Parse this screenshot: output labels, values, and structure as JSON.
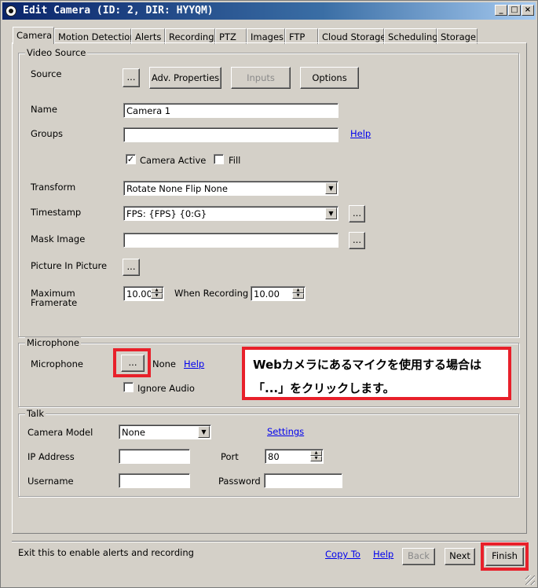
{
  "window": {
    "title": "Edit Camera (ID: 2, DIR: HYYQM)",
    "min": "_",
    "max": "□",
    "close": "×"
  },
  "tabs": [
    "Camera",
    "Motion Detection",
    "Alerts",
    "Recording",
    "PTZ",
    "Images",
    "FTP",
    "Cloud Storage",
    "Scheduling",
    "Storage"
  ],
  "video_source": {
    "group_label": "Video Source",
    "source_label": "Source",
    "source_browse": "...",
    "adv_properties": "Adv. Properties",
    "inputs": "Inputs",
    "options": "Options",
    "name_label": "Name",
    "name_value": "Camera 1",
    "groups_label": "Groups",
    "groups_value": "",
    "groups_help": "Help",
    "camera_active_label": "Camera Active",
    "camera_active_checked": true,
    "fill_label": "Fill",
    "fill_checked": false,
    "transform_label": "Transform",
    "transform_value": "Rotate None Flip None",
    "timestamp_label": "Timestamp",
    "timestamp_value": "FPS: {FPS} {0:G}",
    "timestamp_browse": "...",
    "mask_label": "Mask Image",
    "mask_value": "",
    "mask_browse": "...",
    "pip_label": "Picture In Picture",
    "pip_browse": "...",
    "max_framerate_label_1": "Maximum",
    "max_framerate_label_2": "Framerate",
    "max_framerate_value": "10.00",
    "when_recording_label": "When Recording",
    "when_recording_value": "10.00"
  },
  "microphone": {
    "group_label": "Microphone",
    "label": "Microphone",
    "browse": "...",
    "value": "None",
    "help": "Help",
    "ignore_audio_label": "Ignore Audio",
    "ignore_audio_checked": false
  },
  "annotation": {
    "line1": "Webカメラにあるマイクを使用する場合は",
    "line2": "「...」をクリックします。",
    "color": "#e8202a"
  },
  "talk": {
    "group_label": "Talk",
    "camera_model_label": "Camera Model",
    "camera_model_value": "None",
    "settings": "Settings",
    "ip_label": "IP Address",
    "ip_value": "",
    "port_label": "Port",
    "port_value": "80",
    "username_label": "Username",
    "username_value": "",
    "password_label": "Password",
    "password_value": ""
  },
  "footer": {
    "status": "Exit this to enable alerts and recording",
    "copy_to": "Copy To",
    "help": "Help",
    "back": "Back",
    "next": "Next",
    "finish": "Finish"
  }
}
